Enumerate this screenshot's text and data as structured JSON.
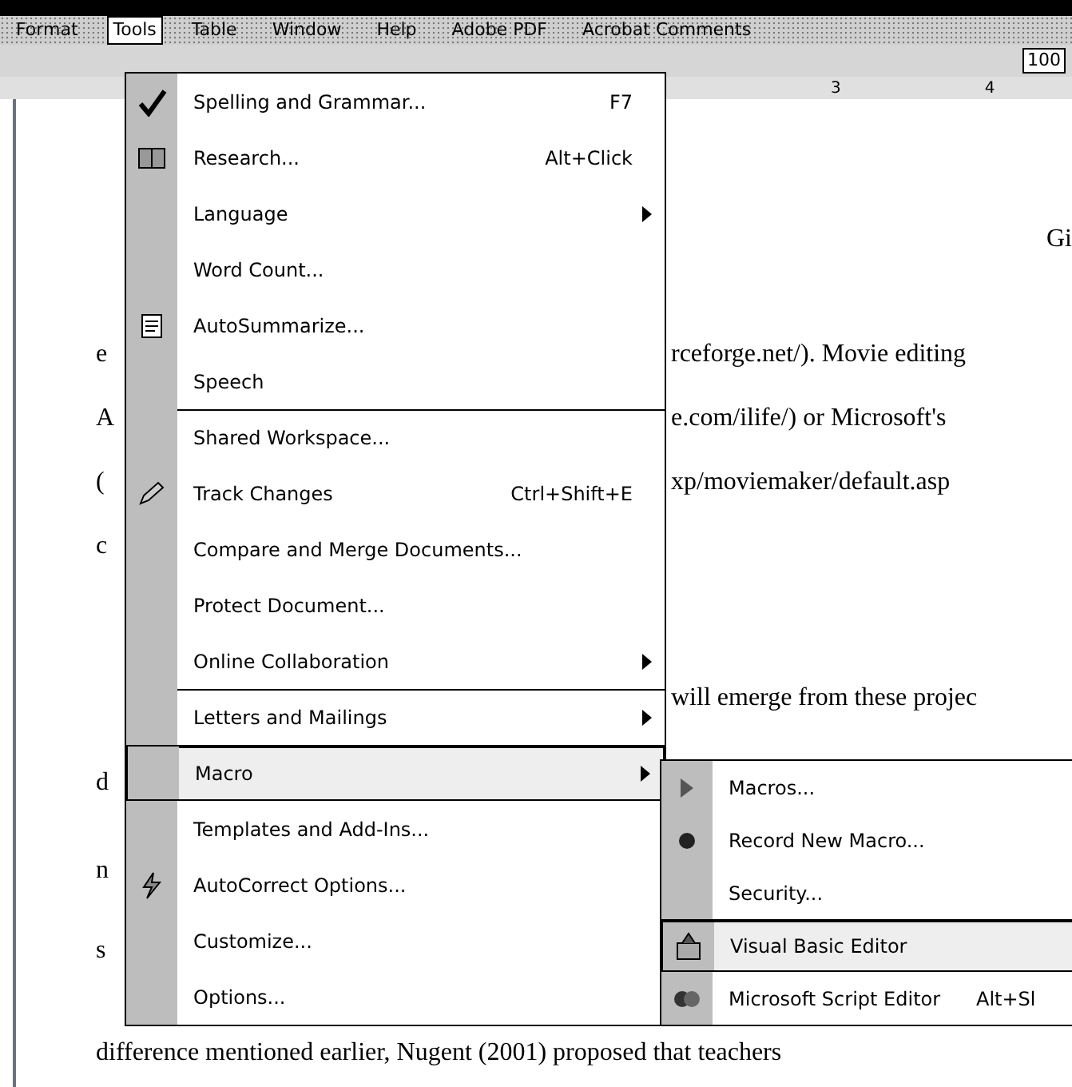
{
  "menu_bar": [
    {
      "label": "Format",
      "selected": false
    },
    {
      "label": "Tools",
      "selected": true
    },
    {
      "label": "Table",
      "selected": false
    },
    {
      "label": "Window",
      "selected": false
    },
    {
      "label": "Help",
      "selected": false
    },
    {
      "label": "Adobe PDF",
      "selected": false
    },
    {
      "label": "Acrobat Comments",
      "selected": false
    }
  ],
  "toolbar": {
    "zoom": "100"
  },
  "ruler": [
    "3",
    "4"
  ],
  "document": {
    "lines": [
      {
        "right": "Gi"
      },
      {
        "left": "e",
        "right": "rceforge.net/). Movie editing"
      },
      {
        "left": "A",
        "right": "e.com/ilife/) or Microsoft's"
      },
      {
        "left": "(",
        "right": "xp/moviemaker/default.asp"
      },
      {
        "left": "c"
      },
      {
        "right": "will emerge from these projec"
      },
      {
        "left": "d"
      },
      {
        "left": "n"
      },
      {
        "left": "s"
      },
      {
        "left": "difference mentioned earlier, Nugent (2001) proposed that teachers"
      }
    ]
  },
  "tools_menu": {
    "items": [
      {
        "label": "Spelling and Grammar...",
        "shortcut": "F7",
        "submenu": false,
        "separator": false,
        "selected": false
      },
      {
        "label": "Research...",
        "shortcut": "Alt+Click",
        "submenu": false,
        "separator": false,
        "selected": false
      },
      {
        "label": "Language",
        "submenu": true,
        "separator": false,
        "selected": false
      },
      {
        "label": "Word Count...",
        "submenu": false,
        "separator": false,
        "selected": false
      },
      {
        "label": "AutoSummarize...",
        "submenu": false,
        "separator": false,
        "selected": false
      },
      {
        "label": "Speech",
        "submenu": false,
        "separator": false,
        "selected": false
      },
      {
        "label": "Shared Workspace...",
        "submenu": false,
        "separator": true,
        "selected": false
      },
      {
        "label": "Track Changes",
        "shortcut": "Ctrl+Shift+E",
        "submenu": false,
        "separator": false,
        "selected": false
      },
      {
        "label": "Compare and Merge Documents...",
        "submenu": false,
        "separator": false,
        "selected": false
      },
      {
        "label": "Protect Document...",
        "submenu": false,
        "separator": false,
        "selected": false
      },
      {
        "label": "Online Collaboration",
        "submenu": true,
        "separator": false,
        "selected": false
      },
      {
        "label": "Letters and Mailings",
        "submenu": true,
        "separator": true,
        "selected": false
      },
      {
        "label": "Macro",
        "submenu": true,
        "separator": true,
        "selected": true
      },
      {
        "label": "Templates and Add-Ins...",
        "submenu": false,
        "separator": false,
        "selected": false
      },
      {
        "label": "AutoCorrect Options...",
        "submenu": false,
        "separator": false,
        "selected": false
      },
      {
        "label": "Customize...",
        "submenu": false,
        "separator": false,
        "selected": false
      },
      {
        "label": "Options...",
        "submenu": false,
        "separator": false,
        "selected": false
      }
    ]
  },
  "macro_menu": {
    "items": [
      {
        "label": "Macros...",
        "separator": false,
        "selected": false
      },
      {
        "label": "Record New Macro...",
        "separator": false,
        "selected": false
      },
      {
        "label": "Security...",
        "separator": false,
        "selected": false
      },
      {
        "label": "Visual Basic Editor",
        "separator": true,
        "selected": true
      },
      {
        "label": "Microsoft Script Editor",
        "shortcut": "Alt+Sl",
        "separator": false,
        "selected": false
      }
    ]
  }
}
